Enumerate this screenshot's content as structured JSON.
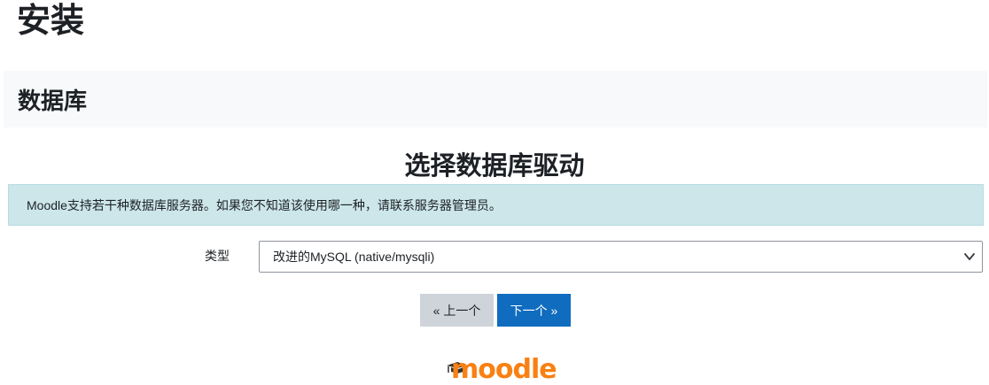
{
  "page": {
    "title": "安装"
  },
  "stage": {
    "title": "数据库"
  },
  "section": {
    "heading": "选择数据库驱动"
  },
  "info": {
    "text": "Moodle支持若干种数据库服务器。如果您不知道该使用哪一种，请联系服务器管理员。"
  },
  "form": {
    "type_label": "类型",
    "type_selected": "改进的MySQL (native/mysqli)"
  },
  "buttons": {
    "prev_label": "« 上一个",
    "next_label": "下一个 »"
  },
  "footer": {
    "logo_text": "moodle"
  },
  "colors": {
    "stage_bg": "#f8f9fa",
    "info_bg": "#cce6ea",
    "btn_prev_bg": "#ced4da",
    "btn_next_bg": "#0f6cbf",
    "logo_orange": "#f98012"
  },
  "icons": {
    "select_chevron": "chevron-down-icon",
    "logo_cap": "mortarboard-icon"
  }
}
